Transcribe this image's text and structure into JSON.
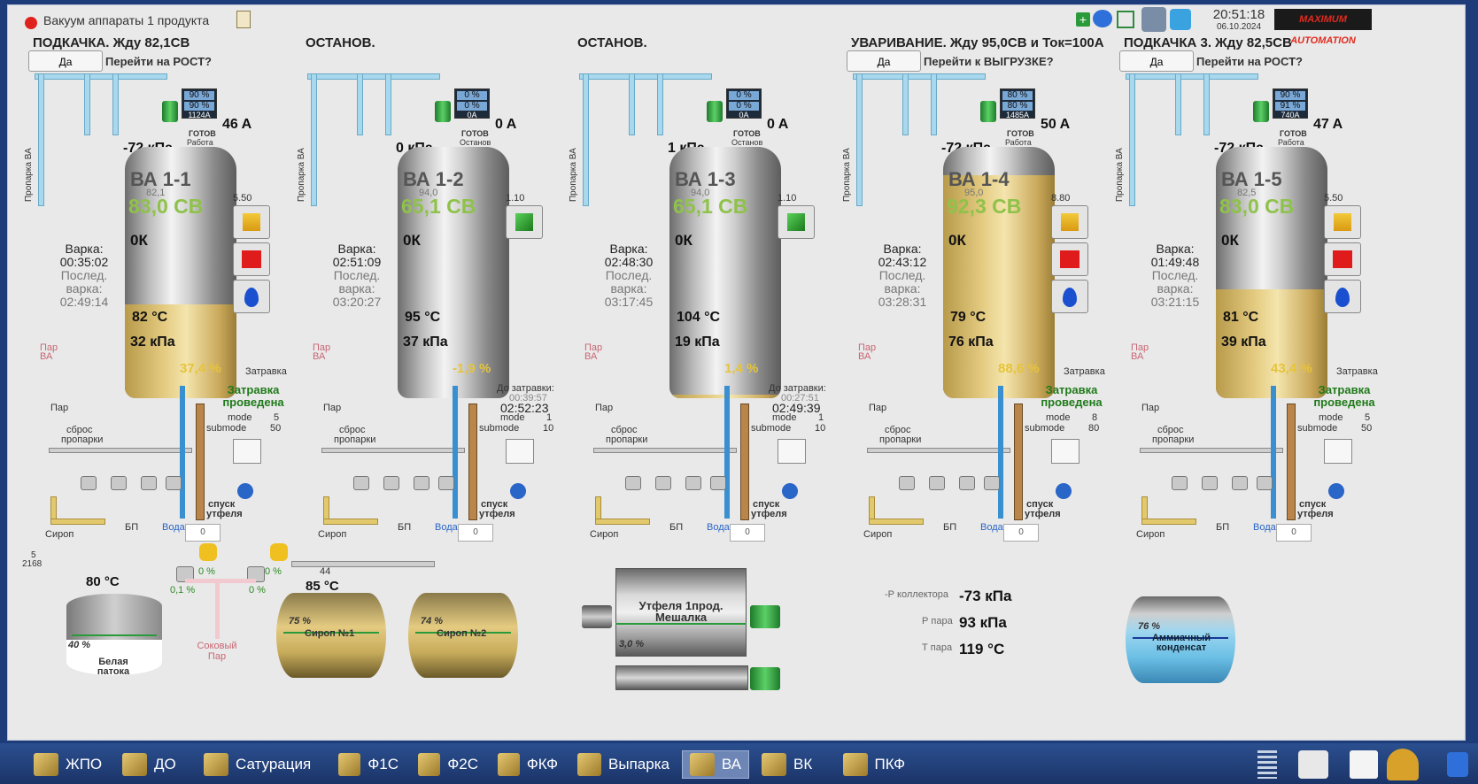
{
  "window": {
    "title": "Вакуум аппараты 1 продукта",
    "time": "20:51:18",
    "date": "06.10.2024",
    "logo": "MAXIMUM AUTOMATION"
  },
  "headers": [
    "ПОДКАЧКА. Жду 82,1СВ",
    "ОСТАНОВ.",
    "ОСТАНОВ.",
    "УВАРИВАНИЕ. Жду 95,0СВ  и Ток=100А",
    "ПОДКАЧКА 3. Жду 82,5СВ"
  ],
  "prompts": [
    {
      "btn": "Да",
      "q": "Перейти на РОСТ?"
    },
    {
      "btn": "Да",
      "q": "Перейти к  ВЫГРУЗКЕ?"
    },
    {
      "btn": "Да",
      "q": "Перейти на РОСТ?"
    }
  ],
  "vessels": [
    {
      "name": "ВА 1-1",
      "cv": "83,0 СВ",
      "cv_set": "82,1",
      "kk": "0К",
      "temp": "82 °C",
      "press": "32 кПа",
      "level": "37,4 %",
      "level_val": 37.4,
      "top_p": "-72 кПа",
      "current": "46 A",
      "amps": "1124A",
      "screen1": "90 %",
      "screen2": "90 %",
      "status": "ГОТОВ",
      "status2": "Работа",
      "set_small": "5.50",
      "varka": "00:35:02",
      "last": "02:49:14",
      "mode": "5",
      "submode": "50",
      "run": "pause",
      "zatr_a": "Затравка",
      "zatr_b": "проведена"
    },
    {
      "name": "ВА 1-2",
      "cv": "65,1 СВ",
      "cv_set": "94,0",
      "kk": "0К",
      "temp": "95 °C",
      "press": "37 кПа",
      "level": "-1,9 %",
      "level_val": 0,
      "top_p": "0 кПа",
      "current": "0 A",
      "amps": "0A",
      "screen1": "0 %",
      "screen2": "0 %",
      "status": "ГОТОВ",
      "status2": "Останов",
      "set_small": "1.10",
      "varka": "02:51:09",
      "last": "03:20:27",
      "mode": "1",
      "submode": "10",
      "run": "play",
      "zatr_a": "До затравки:",
      "zatr_b": "00:39:57",
      "zatr_c": "02:52:23"
    },
    {
      "name": "ВА 1-3",
      "cv": "65,1 СВ",
      "cv_set": "94,0",
      "kk": "0К",
      "temp": "104 °C",
      "press": "19 кПа",
      "level": "1,4 %",
      "level_val": 1.4,
      "top_p": "1 кПа",
      "current": "0 A",
      "amps": "0A",
      "screen1": "0 %",
      "screen2": "0 %",
      "status": "ГОТОВ",
      "status2": "Останов",
      "set_small": "1.10",
      "varka": "02:48:30",
      "last": "03:17:45",
      "mode": "1",
      "submode": "10",
      "run": "play",
      "zatr_a": "До затравки:",
      "zatr_b": "00:27:51",
      "zatr_c": "02:49:39"
    },
    {
      "name": "ВА 1-4",
      "cv": "92,3 СВ",
      "cv_set": "95,0",
      "kk": "0К",
      "temp": "79 °C",
      "press": "76 кПа",
      "level": "88,6 %",
      "level_val": 88.6,
      "top_p": "-72 кПа",
      "current": "50 A",
      "amps": "1485A",
      "screen1": "80 %",
      "screen2": "80 %",
      "status": "ГОТОВ",
      "status2": "Работа",
      "set_small": "8.80",
      "varka": "02:43:12",
      "last": "03:28:31",
      "mode": "8",
      "submode": "80",
      "run": "pause",
      "zatr_a": "Затравка",
      "zatr_b": "проведена"
    },
    {
      "name": "ВА 1-5",
      "cv": "83,0 СВ",
      "cv_set": "82,5",
      "kk": "0К",
      "temp": "81 °C",
      "press": "39 кПа",
      "level": "43,4 %",
      "level_val": 43.4,
      "top_p": "-72 кПа",
      "current": "47 A",
      "amps": "740A",
      "screen1": "90 %",
      "screen2": "91 %",
      "status": "ГОТОВ",
      "status2": "Работа",
      "set_small": "5.50",
      "varka": "01:49:48",
      "last": "03:21:15",
      "mode": "5",
      "submode": "50",
      "run": "pause",
      "zatr_a": "Затравка",
      "zatr_b": "проведена"
    }
  ],
  "common": {
    "varka_label": "Варка:",
    "last_label1": "Послед.",
    "last_label2": "варка:",
    "mode_label": "mode",
    "submode_label": "submode",
    "par": "Пар",
    "sbros": "сброс",
    "propark": "пропарки",
    "sirop": "Сироп",
    "bp": "БП",
    "voda": "Вода",
    "spusk": "спуск",
    "utfel": "утфеля",
    "proparka_va": "Пропарка ВА",
    "par_va": "Пар ВА",
    "gauge": "0"
  },
  "bottom": {
    "small_top": "5",
    "small_num": "2168",
    "patoka_temp": "80 °C",
    "patoka_level": "40 %",
    "patoka_name": "Белая патока",
    "valve1": "0,1 %",
    "valve2": "0 %",
    "valve3": "0 %",
    "valve4": "0 %",
    "sok_par": "Соковый Пар",
    "sirop_temp": "85 °C",
    "sirop_top": "44",
    "sirop1_level": "75 %",
    "sirop1": "Сироп №1",
    "sirop2_level": "74 %",
    "sirop2": "Сироп №2",
    "mixer": "Утфеля 1прод. Мешалка",
    "mixer_level": "3,0 %",
    "p_coll_label": "-Р коллектора",
    "p_coll": "-73 кПа",
    "p_par_label": "Р пара",
    "p_par": "93 кПа",
    "t_par_label": "Т пара",
    "t_par": "119 °C",
    "ammonia_level": "76 %",
    "ammonia": "Аммиачный конденсат"
  },
  "taskbar": [
    "ЖПО",
    "ДО",
    "Сатурация",
    "Ф1С",
    "Ф2С",
    "ФКФ",
    "Выпарка",
    "ВА",
    "ВК",
    "ПКФ"
  ],
  "taskbar_active": "ВА",
  "colors": {
    "green": "#8fc24a",
    "pipe": "#a7d8ee",
    "fill": "#e4cb81",
    "taskbar": "#1b3468"
  }
}
